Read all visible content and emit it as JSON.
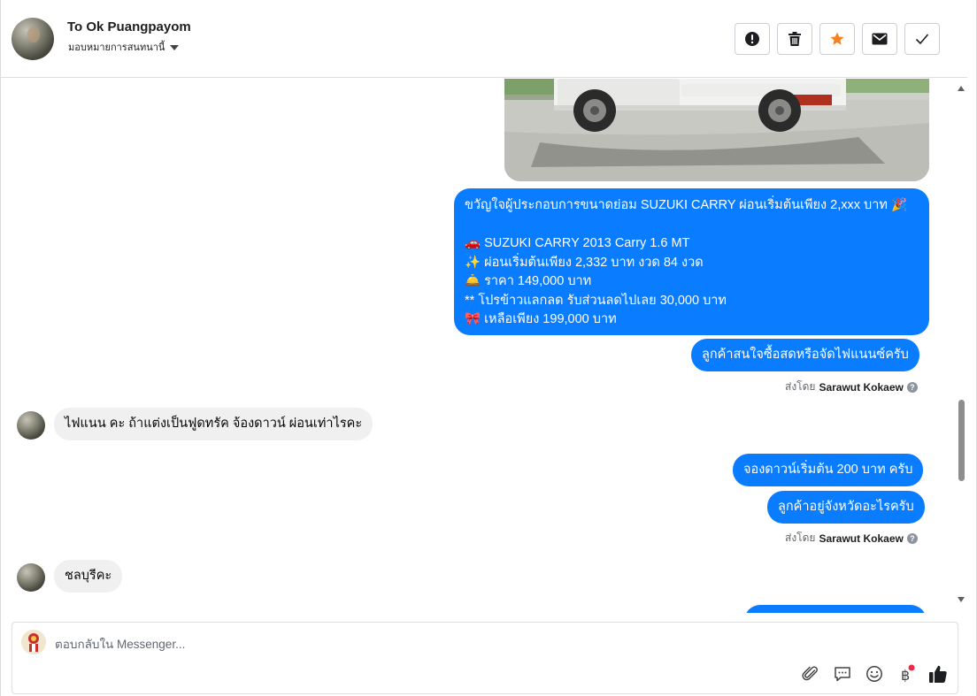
{
  "header": {
    "contact_name": "To Ok Puangpayom",
    "assign_label": "มอบหมายการสนทนานี้"
  },
  "toolbar": {
    "spam_icon": "exclamation-icon",
    "delete_icon": "trash-icon",
    "star_icon": "star-icon",
    "unread_icon": "envelope-icon",
    "done_icon": "check-icon",
    "star_color": "#f5821f"
  },
  "messages": {
    "promo_lines": [
      "ขวัญใจผู้ประกอบการขนาดย่อม SUZUKI CARRY ผ่อนเริ่มต้นเพียง 2,xxx บาท 🎉",
      "",
      "🚗 SUZUKI CARRY 2013 Carry 1.6 MT",
      "✨ ผ่อนเริ่มต้นเพียง 2,332 บาท งวด 84 งวด",
      "🛎️ ราคา 149,000 บาท",
      "** โปรข้าวแลกลด รับส่วนลดไปเลย 30,000 บาท",
      "🎀 เหลือเพียง 199,000 บาท"
    ],
    "out_1": "ลูกค้าสนใจซื้อสดหรือจัดไฟแนนซ์ครับ",
    "sent_by_prefix": "ส่งโดย",
    "sent_by_name": "Sarawut Kokaew",
    "in_1": "ไฟแนน คะ ถ้าแต่งเป็นฟูดทรัค จ้องดาวน์ ผ่อนเท่าไรคะ",
    "out_2": "จองดาวน์เริ่มต้น 200 บาท ครับ",
    "out_3": "ลูกค้าอยู่จังหวัดอะไรครับ",
    "in_2": "ชลบุรีคะ",
    "out_color": "#0a7cff"
  },
  "composer": {
    "placeholder": "ตอบกลับใน Messenger...",
    "icons": [
      "paperclip-icon",
      "saved-reply-icon",
      "emoji-icon",
      "baht-payment-icon",
      "like-icon"
    ]
  }
}
